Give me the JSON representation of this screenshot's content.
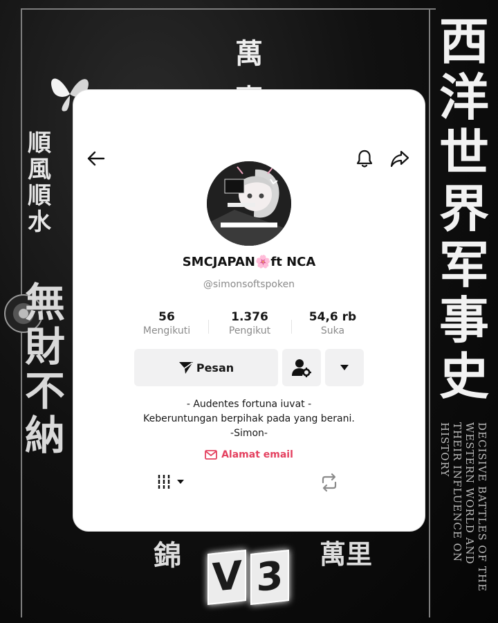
{
  "background": {
    "left_column_small": [
      "順",
      "風",
      "順",
      "水"
    ],
    "left_column_large": [
      "無",
      "財",
      "不",
      "納"
    ],
    "title_column": [
      "西",
      "洋",
      "世",
      "界",
      "军",
      "事",
      "史"
    ],
    "subtitle_vertical": "DECISIVE BATTLES OF THE WESTERN WORLD AND THEIR INFLUENCE ON HISTORY",
    "top_column": [
      "萬",
      "事"
    ],
    "bottom_chars_left": "錦",
    "bottom_chars_right": "萬里",
    "badge": [
      "V",
      "3"
    ]
  },
  "profile": {
    "display_name": "SMCJAPAN🌸ft NCA",
    "handle": "@simonsoftspoken",
    "stats": [
      {
        "value": "56",
        "label": "Mengikuti"
      },
      {
        "value": "1.376",
        "label": "Pengikut"
      },
      {
        "value": "54,6 rb",
        "label": "Suka"
      }
    ],
    "message_button": "Pesan",
    "bio": [
      "- Audentes fortuna iuvat -",
      "Keberuntungan berpihak pada yang berani.",
      "-Simon-"
    ],
    "email_label": "Alamat email"
  },
  "colors": {
    "accent": "#e4405f",
    "card_bg": "#ffffff",
    "button_bg": "#f1f1f2"
  },
  "icons": {
    "back": "arrow-left-icon",
    "bell": "bell-icon",
    "share": "share-icon",
    "add_friend": "user-settings-icon",
    "dropdown": "caret-down-icon",
    "grid_tab": "grid-tab-icon",
    "repost_tab": "repost-icon"
  }
}
